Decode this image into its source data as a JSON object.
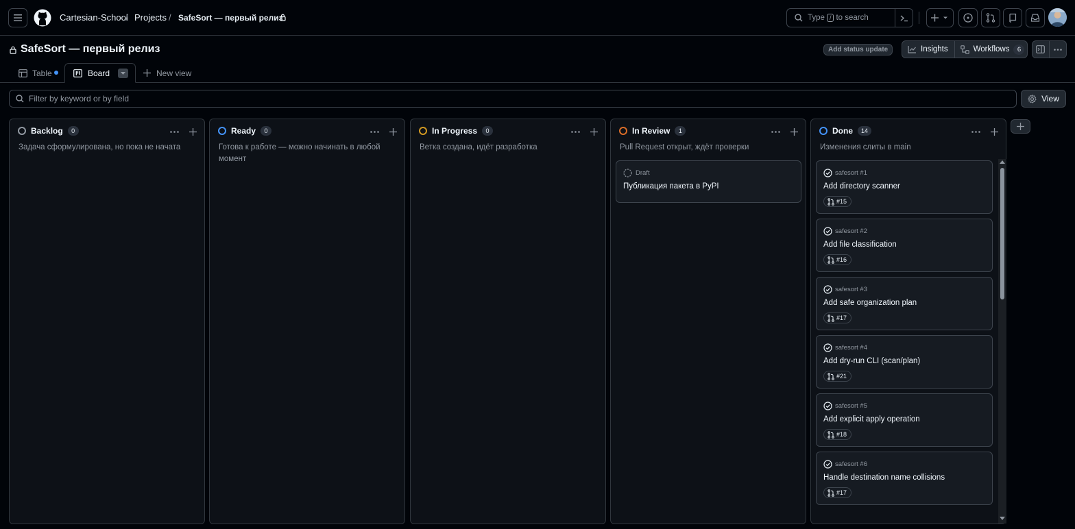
{
  "header": {
    "breadcrumbs": [
      "Cartesian-School",
      "Projects",
      "SafeSort — первый релиз"
    ],
    "separator": "/",
    "search": {
      "prefix": "Type",
      "key": "/",
      "suffix": "to search"
    }
  },
  "project": {
    "title": "SafeSort — первый релиз",
    "status_button": "Add status update",
    "insights_label": "Insights",
    "workflows_label": "Workflows",
    "workflows_count": "6"
  },
  "tabs": [
    {
      "label": "Table"
    },
    {
      "label": "Board"
    }
  ],
  "new_view_label": "New view",
  "filter": {
    "placeholder": "Filter by keyword or by field"
  },
  "view_button": "View",
  "columns": [
    {
      "name": "Backlog",
      "count": "0",
      "description": "Задача сформулирована, но пока не начата",
      "color": "#9198a1"
    },
    {
      "name": "Ready",
      "count": "0",
      "description": "Готова к работе — можно начинать в любой момент",
      "color": "#4493f8"
    },
    {
      "name": "In Progress",
      "count": "0",
      "description": "Ветка создана, идёт разработка",
      "color": "#d29922"
    },
    {
      "name": "In Review",
      "count": "1",
      "description": "Pull Request открыт, ждёт проверки",
      "color": "#db6d28"
    },
    {
      "name": "Done",
      "count": "14",
      "description": "Изменения слиты в main",
      "color": "#4493f8"
    }
  ],
  "review_card": {
    "meta": "Draft",
    "title": "Публикация пакета в PyPI"
  },
  "done_cards": [
    {
      "meta": "safesort #1",
      "title": "Add directory scanner",
      "pr": "#15"
    },
    {
      "meta": "safesort #2",
      "title": "Add file classification",
      "pr": "#16"
    },
    {
      "meta": "safesort #3",
      "title": "Add safe organization plan",
      "pr": "#17"
    },
    {
      "meta": "safesort #4",
      "title": "Add dry-run CLI (scan/plan)",
      "pr": "#21"
    },
    {
      "meta": "safesort #5",
      "title": "Add explicit apply operation",
      "pr": "#18"
    },
    {
      "meta": "safesort #6",
      "title": "Handle destination name collisions",
      "pr": "#17"
    }
  ]
}
